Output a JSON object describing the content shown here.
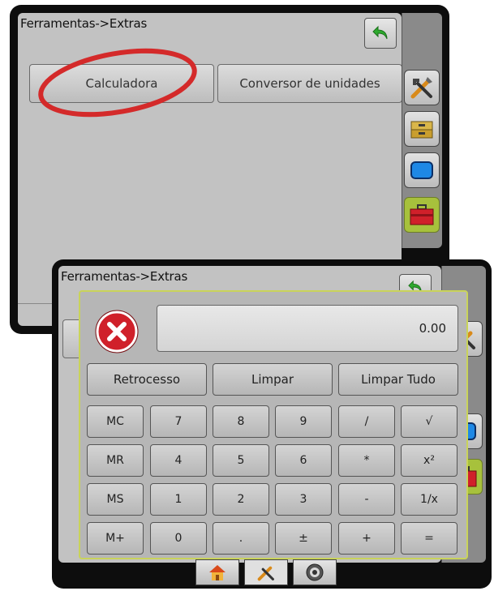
{
  "back_screen": {
    "title": "Ferramentas->Extras",
    "buttons": [
      "Calculadora",
      "Conversor de unidades"
    ],
    "sidebar_icons": [
      "tools-icon",
      "drawer-icon",
      "monitor-icon",
      "toolbox-icon"
    ]
  },
  "front_screen": {
    "title": "Ferramentas->Extras"
  },
  "calculator": {
    "display_value": "0.00",
    "row1": [
      "Retrocesso",
      "Limpar",
      "Limpar Tudo"
    ],
    "keys": [
      [
        "MC",
        "7",
        "8",
        "9",
        "/",
        "√"
      ],
      [
        "MR",
        "4",
        "5",
        "6",
        "*",
        "x²"
      ],
      [
        "MS",
        "1",
        "2",
        "3",
        "-",
        "1/x"
      ],
      [
        "M+",
        "0",
        ".",
        "±",
        "+",
        "="
      ]
    ]
  },
  "bottom_tabs": [
    "home-icon",
    "tools-icon",
    "gauge-icon"
  ],
  "colors": {
    "annotation_circle": "#d42a2a",
    "dialog_border": "#c9d35a",
    "active_sidebar": "#a7c13c",
    "toolbox_red": "#d0202a"
  }
}
